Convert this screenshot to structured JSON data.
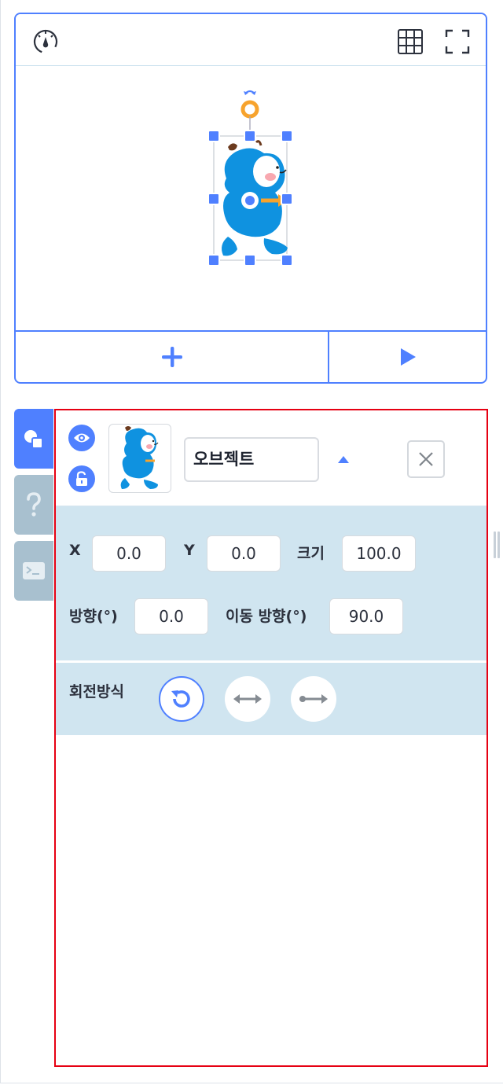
{
  "stage": {
    "speed_icon": "speedometer-icon",
    "grid_icon": "grid-icon",
    "fullscreen_icon": "fullscreen-icon",
    "add_icon": "plus-icon",
    "run_icon": "play-icon"
  },
  "tabs": [
    {
      "name": "object",
      "icon": "object-shapes-icon",
      "active": true
    },
    {
      "name": "help",
      "icon": "question-icon",
      "active": false
    },
    {
      "name": "console",
      "icon": "terminal-icon",
      "active": false
    }
  ],
  "object": {
    "name": "오브젝트",
    "visible_icon": "eye-icon",
    "lock_icon": "unlock-icon",
    "fold_icon": "triangle-up-icon",
    "delete_icon": "close-icon",
    "x_label": "X",
    "x_value": "0.0",
    "y_label": "Y",
    "y_value": "0.0",
    "size_label": "크기",
    "size_value": "100.0",
    "direction_label": "방향(°)",
    "direction_value": "0.0",
    "move_direction_label": "이동 방향(°)",
    "move_direction_value": "90.0",
    "rotation_label": "회전방식",
    "rotation_modes": [
      "free-rotation",
      "left-right",
      "none"
    ],
    "selected_rotation": "free-rotation"
  },
  "colors": {
    "accent": "#4f80ff",
    "panel_bg": "#d0e5f0",
    "tab_inactive": "#a8c0cf",
    "highlight_border": "#e60012",
    "character_blue": "#0f92e0",
    "handle_orange": "#f7a32d"
  }
}
